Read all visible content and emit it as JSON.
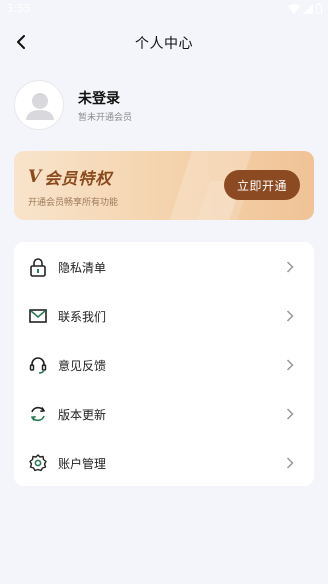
{
  "status_bar": {
    "time": "3:55"
  },
  "nav": {
    "title": "个人中心"
  },
  "profile": {
    "name": "未登录",
    "status": "暂未开通会员"
  },
  "vip": {
    "badge": "V",
    "title": "会员特权",
    "subtitle": "开通会员畅享所有功能",
    "button": "立即开通"
  },
  "menu": [
    {
      "label": "隐私清单",
      "icon": "lock-icon"
    },
    {
      "label": "联系我们",
      "icon": "mail-icon"
    },
    {
      "label": "意见反馈",
      "icon": "headset-icon"
    },
    {
      "label": "版本更新",
      "icon": "refresh-icon"
    },
    {
      "label": "账户管理",
      "icon": "gear-icon"
    }
  ],
  "colors": {
    "accent": "#8b4a22",
    "icon_green": "#2c7a57",
    "background": "#f4f5fa"
  }
}
